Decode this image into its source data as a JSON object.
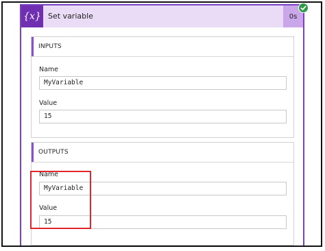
{
  "action": {
    "icon": "variable-icon",
    "icon_glyph": "{x}",
    "title": "Set variable",
    "duration": "0s",
    "status": "succeeded",
    "status_icon": "success-check-icon"
  },
  "inputs": {
    "heading": "INPUTS",
    "name_label": "Name",
    "name_value": "MyVariable",
    "value_label": "Value",
    "value_value": "15"
  },
  "outputs": {
    "heading": "OUTPUTS",
    "name_label": "Name",
    "name_value": "MyVariable",
    "value_label": "Value",
    "value_value": "15"
  },
  "colors": {
    "accent": "#6f2fb0",
    "header_bg": "#eadcf6",
    "duration_bg": "#c9a7e8",
    "success": "#2e9b46",
    "highlight": "#e0262a"
  }
}
